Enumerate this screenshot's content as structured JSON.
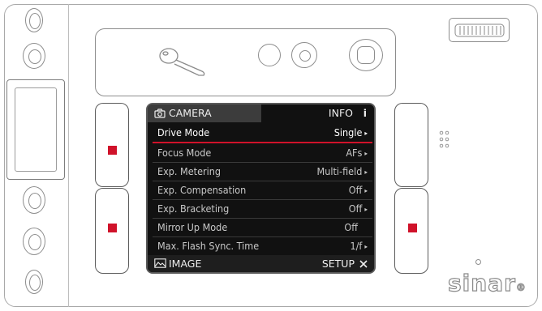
{
  "menu": {
    "tab_camera": "CAMERA",
    "tab_info": "INFO",
    "info_icon": "i",
    "items": [
      {
        "label": "Drive Mode",
        "value": "Single",
        "arrow": "▸"
      },
      {
        "label": "Focus Mode",
        "value": "AFs",
        "arrow": "▸"
      },
      {
        "label": "Exp. Metering",
        "value": "Multi-field",
        "arrow": "▸"
      },
      {
        "label": "Exp. Compensation",
        "value": "Off",
        "arrow": "▸"
      },
      {
        "label": "Exp. Bracketing",
        "value": "Off",
        "arrow": "▸"
      },
      {
        "label": "Mirror Up Mode",
        "value": "Off",
        "arrow": ""
      },
      {
        "label": "Max. Flash Sync. Time",
        "value": "1/f",
        "arrow": "▸"
      }
    ],
    "footer_left": "IMAGE",
    "footer_right": "SETUP"
  },
  "brand": {
    "logo_text": "sinar",
    "logo_mark": "®"
  },
  "colors": {
    "accent": "#d0122a",
    "screen_bg": "#111111",
    "header_bg": "#3c3c3c"
  },
  "icons": {
    "camera": "camera-icon",
    "info": "info-icon",
    "image": "image-icon",
    "setup": "tools-icon"
  }
}
